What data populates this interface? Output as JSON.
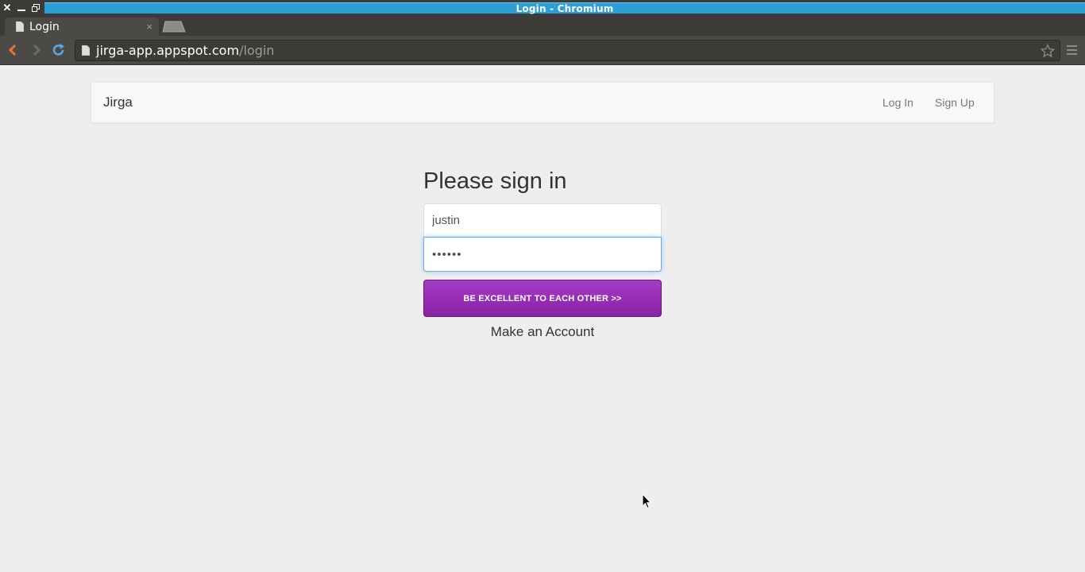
{
  "window": {
    "title": "Login - Chromium",
    "controls": [
      "close-icon",
      "minimize-icon",
      "maximize-icon"
    ]
  },
  "tabs": [
    {
      "label": "Login",
      "active": true
    }
  ],
  "toolbar": {
    "url_host": "jirga-app.appspot.com",
    "url_path": "/login"
  },
  "navbar": {
    "brand": "Jirga",
    "links": [
      "Log In",
      "Sign Up"
    ]
  },
  "form": {
    "heading": "Please sign in",
    "username_value": "justin",
    "password_value": "••••••",
    "submit_label": "BE EXCELLENT TO EACH OTHER >>",
    "make_account": "Make an Account"
  },
  "colors": {
    "titlebar_accent": "#2b9fd6",
    "button_purple": "#9b2fbb",
    "page_background": "#eeeeee",
    "focus_border": "#66afe9"
  }
}
